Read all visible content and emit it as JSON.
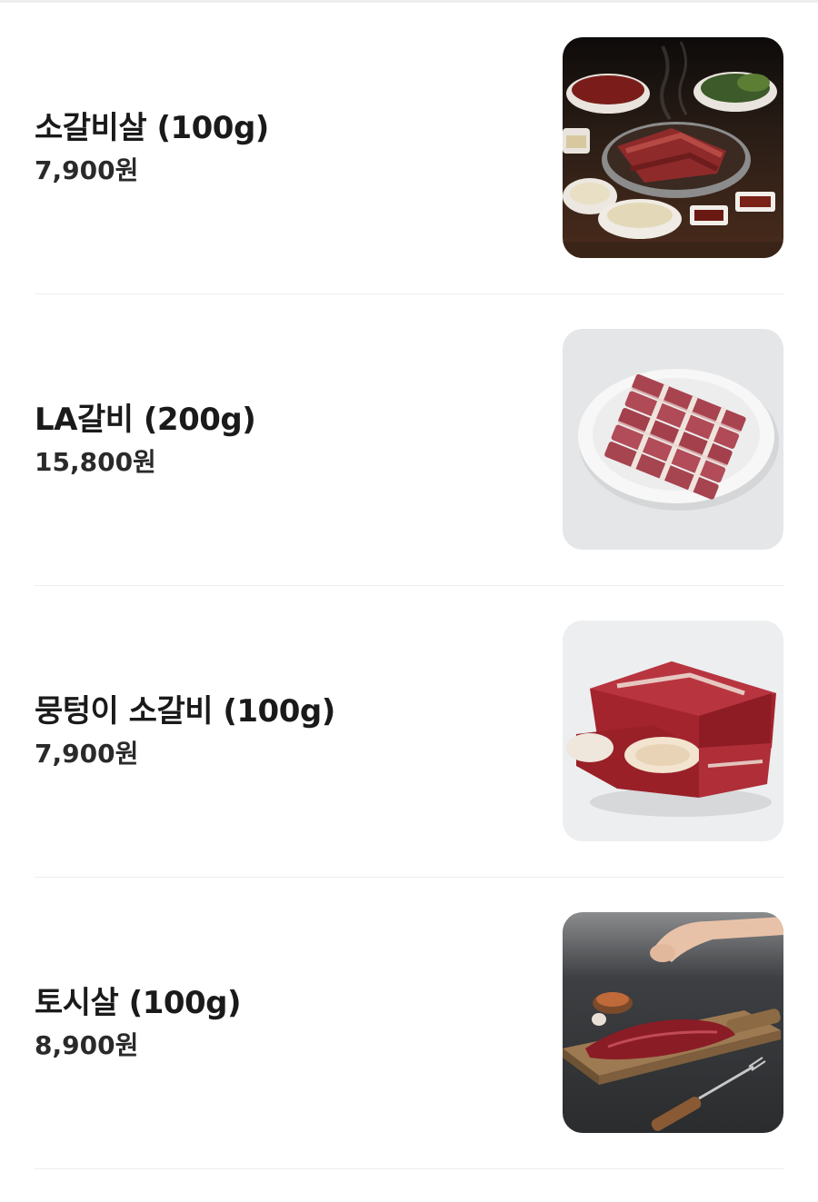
{
  "menu": {
    "items": [
      {
        "name": "소갈비살 (100g)",
        "price": "7,900원",
        "image": "grilled-beef-rib-meat-photo"
      },
      {
        "name": "LA갈비 (200g)",
        "price": "15,800원",
        "image": "la-galbi-plate-photo"
      },
      {
        "name": "뭉텅이 소갈비 (100g)",
        "price": "7,900원",
        "image": "chunk-beef-rib-photo"
      },
      {
        "name": "토시살 (100g)",
        "price": "8,900원",
        "image": "hanger-steak-board-photo"
      }
    ]
  }
}
